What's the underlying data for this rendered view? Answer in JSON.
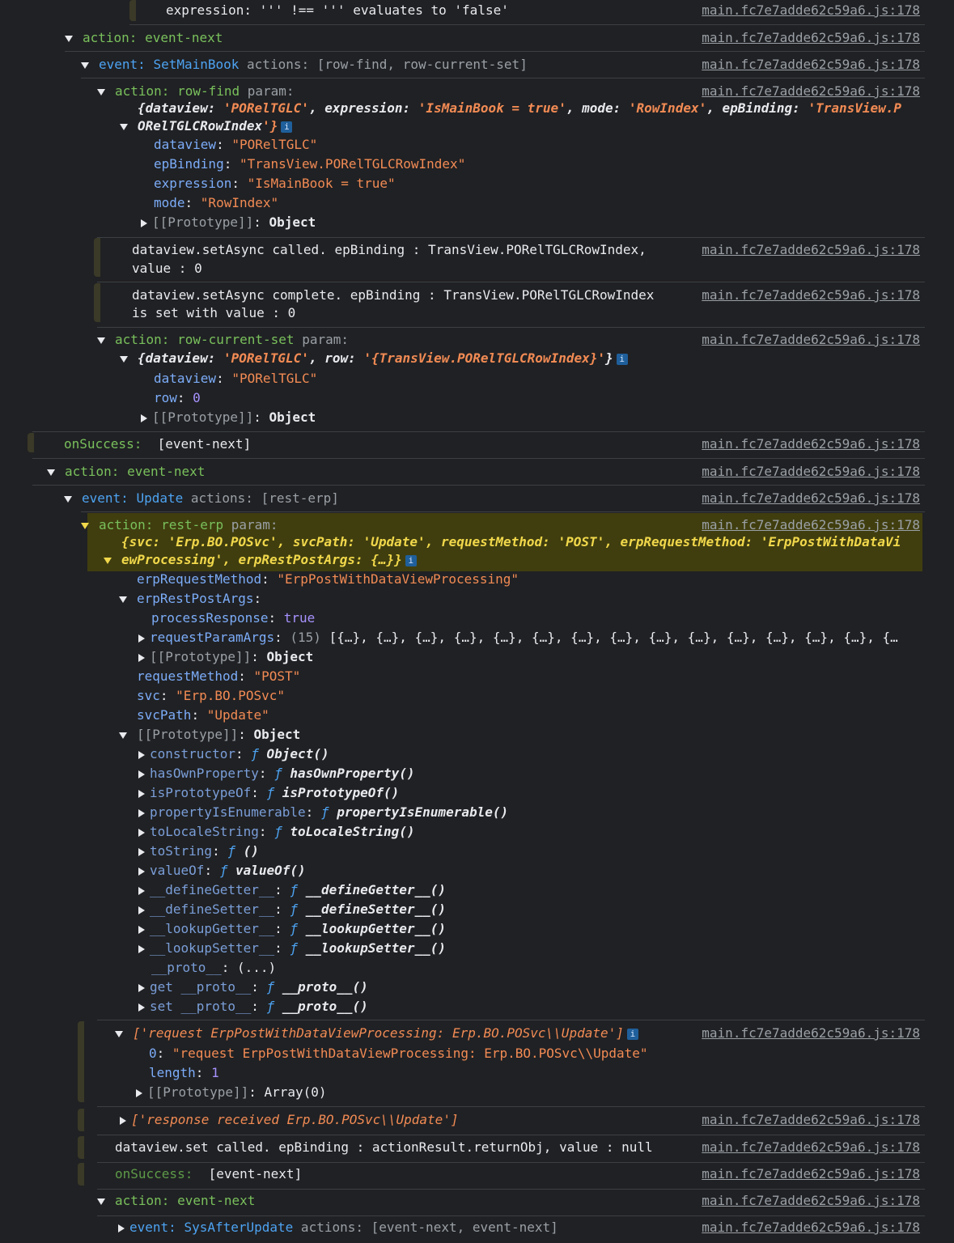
{
  "source_link": "main.fc7e7adde62c59a6.js:178",
  "lines": {
    "expr": "expression: ''' !== ''' evaluates to 'false'",
    "action_event_next": "action: event-next",
    "event_setmainbook": "event: ",
    "event_setmainbook_name": "SetMainBook",
    "event_setmainbook_actions": " actions: [row-find, row-current-set]",
    "action_row_find": "action: row-find",
    "param": " param:",
    "row_find_obj_1": "{dataview: 'PORelTGLC', expression: 'IsMainBook = true', mode: 'RowIndex', epBinding: 'TransView.P",
    "row_find_obj_2": "ORelTGLCRowIndex'}",
    "rf_dataview_k": "dataview",
    "rf_dataview_v": "\"PORelTGLC\"",
    "rf_epbinding_k": "epBinding",
    "rf_epbinding_v": "\"TransView.PORelTGLCRowIndex\"",
    "rf_expression_k": "expression",
    "rf_expression_v": "\"IsMainBook = true\"",
    "rf_mode_k": "mode",
    "rf_mode_v": "\"RowIndex\"",
    "prototype_k": "[[Prototype]]",
    "prototype_obj": "Object",
    "setasync_called_1": "dataview.setAsync called. epBinding : TransView.PORelTGLCRowIndex,",
    "setasync_called_2": "value : 0",
    "setasync_complete_1": "dataview.setAsync complete. epBinding : TransView.PORelTGLCRowIndex",
    "setasync_complete_2": "is set with value : 0",
    "action_row_current_set": "action: row-current-set",
    "rcs_obj": "{dataview: 'PORelTGLC', row: '{TransView.PORelTGLCRowIndex}'}",
    "rcs_dataview_k": "dataview",
    "rcs_dataview_v": "\"PORelTGLC\"",
    "rcs_row_k": "row",
    "rcs_row_v": "0",
    "onsuccess": "onSuccess: ",
    "onsuccess_val": " [event-next]",
    "event_update_name": "Update",
    "event_update_actions": " actions: [rest-erp]",
    "action_rest_erp": "action: rest-erp",
    "rest_obj_1": "{svc: 'Erp.BO.POSvc', svcPath: 'Update', requestMethod: 'POST', erpRequestMethod: 'ErpPostWithDataVi",
    "rest_obj_2": "ewProcessing', erpRestPostArgs: {…}}",
    "erp_req_method_k": "erpRequestMethod",
    "erp_req_method_v": "\"ErpPostWithDataViewProcessing\"",
    "erp_rest_post_args_k": "erpRestPostArgs",
    "process_response_k": "processResponse",
    "process_response_v": "true",
    "request_param_args_k": "requestParamArgs",
    "request_param_args_count": "(15)",
    "request_param_args_v": "[{…}, {…}, {…}, {…}, {…}, {…}, {…}, {…}, {…}, {…}, {…}, {…}, {…}, {…}, {…",
    "request_method_k": "requestMethod",
    "request_method_v": "\"POST\"",
    "svc_k": "svc",
    "svc_v": "\"Erp.BO.POSvc\"",
    "svc_path_k": "svcPath",
    "svc_path_v": "\"Update\"",
    "f": "ƒ",
    "proto_members": [
      {
        "k": "constructor",
        "v": "Object()"
      },
      {
        "k": "hasOwnProperty",
        "v": "hasOwnProperty()"
      },
      {
        "k": "isPrototypeOf",
        "v": "isPrototypeOf()"
      },
      {
        "k": "propertyIsEnumerable",
        "v": "propertyIsEnumerable()"
      },
      {
        "k": "toLocaleString",
        "v": "toLocaleString()"
      },
      {
        "k": "toString",
        "v": "()"
      },
      {
        "k": "valueOf",
        "v": "valueOf()"
      },
      {
        "k": "__defineGetter__",
        "v": "__defineGetter__()"
      },
      {
        "k": "__defineSetter__",
        "v": "__defineSetter__()"
      },
      {
        "k": "__lookupGetter__",
        "v": "__lookupGetter__()"
      },
      {
        "k": "__lookupSetter__",
        "v": "__lookupSetter__()"
      }
    ],
    "proto_k": "__proto__",
    "proto_v": "(...)",
    "get_proto_k": "get __proto__",
    "get_proto_v": "__proto__()",
    "set_proto_k": "set __proto__",
    "set_proto_v": "__proto__()",
    "request_arr": "['request ErpPostWithDataViewProcessing: Erp.BO.POSvc\\\\Update']",
    "arr_0_k": "0",
    "arr_0_v": "\"request ErpPostWithDataViewProcessing: Erp.BO.POSvc\\\\Update\"",
    "length_k": "length",
    "length_v": "1",
    "array_proto": "Array(0)",
    "response_arr": "['response received Erp.BO.POSvc\\\\Update']",
    "dataview_set": "dataview.set called. epBinding : actionResult.returnObj, value : null",
    "event_sysafterupdate_name": "SysAfterUpdate",
    "event_sysafterupdate_actions": " actions: [event-next, event-next]"
  }
}
